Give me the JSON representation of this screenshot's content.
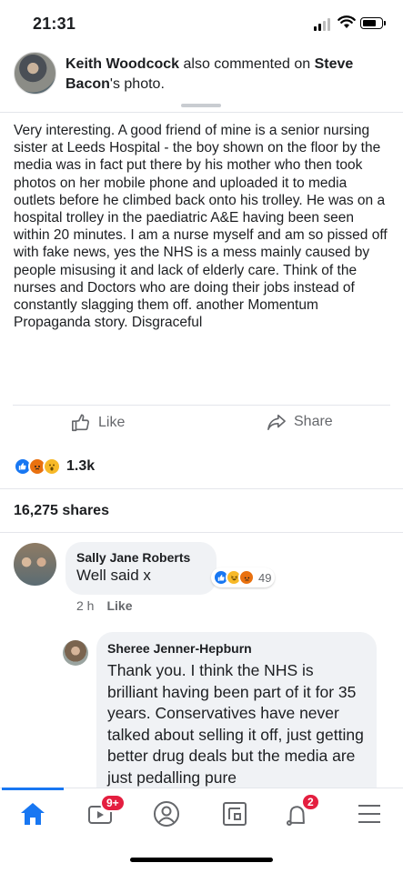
{
  "status_bar": {
    "time": "21:31",
    "signal_bars": 4,
    "signal_bars_active": 2,
    "battery_level": 0.65
  },
  "header": {
    "author": "Keith Woodcock",
    "mid_text": " also commented on ",
    "target": "Steve Bacon",
    "suffix": "'s photo."
  },
  "post": {
    "text": "Very interesting. A good friend of mine is a senior nursing sister at Leeds Hospital - the boy shown on the floor by the media was in fact put there by his mother who then took photos on her mobile phone and uploaded it to media outlets before he climbed back onto his trolley. He was on a hospital trolley in the paediatric A&E having been seen within 20 minutes. I am a nurse myself and am so pissed off with fake news, yes the NHS is a mess mainly caused by people misusing it and lack of elderly care. Think of the nurses and Doctors who are doing their jobs instead of constantly slagging them off. another Momentum\nPropaganda story. Disgraceful"
  },
  "actions": {
    "like_label": "Like",
    "share_label": "Share"
  },
  "reactions": {
    "icons": [
      "like-icon",
      "angry-icon",
      "wow-icon"
    ],
    "count": "1.3k"
  },
  "shares": "16,275 shares",
  "comments": [
    {
      "name": "Sally Jane Roberts",
      "text": "Well said x",
      "time": "2 h",
      "like_label": "Like",
      "reaction_icons": [
        "like-icon",
        "haha-icon",
        "angry-icon"
      ],
      "reaction_count": "49"
    },
    {
      "name": "Sheree Jenner-Hepburn",
      "text": "Thank you. I think the NHS is brilliant having been part of it for 35 years. Conservatives have never talked about selling it off, just getting better drug deals but the media are just pedalling pure"
    }
  ],
  "tabbar": {
    "tabs": [
      "home-icon",
      "watch-icon",
      "profile-icon",
      "groups-icon",
      "notifications-icon",
      "menu-icon"
    ],
    "watch_badge": "9+",
    "notifications_badge": "2",
    "active_color": "#1877f2"
  }
}
